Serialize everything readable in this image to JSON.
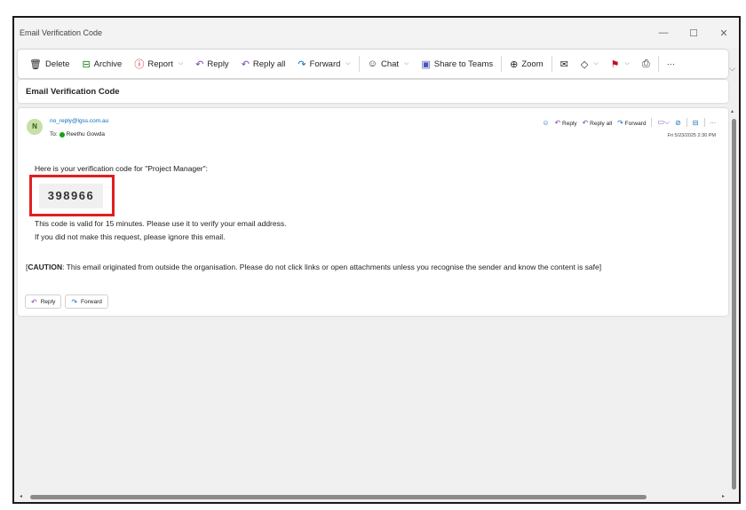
{
  "window": {
    "title": "Email Verification Code",
    "minimize": "—",
    "maximize": "☐",
    "close": "✕"
  },
  "toolbar": {
    "delete": "Delete",
    "archive": "Archive",
    "report": "Report",
    "reply": "Reply",
    "reply_all": "Reply all",
    "forward": "Forward",
    "chat": "Chat",
    "share_to_teams": "Share to Teams",
    "zoom": "Zoom",
    "more": "···"
  },
  "message": {
    "subject": "Email Verification Code",
    "avatar_initial": "N",
    "from": "no_reply@lgss.com.au",
    "to_label": "To:",
    "to_name": "Reethu Gowda",
    "date": "Fri 5/23/2025 2:30 PM",
    "actions": {
      "reply": "Reply",
      "reply_all": "Reply all",
      "forward": "Forward",
      "more": "···"
    },
    "intro": "Here is your verification code for \"Project Manager\":",
    "code": "398966",
    "line1": "This code is valid for 15 minutes. Please use it to verify your email address.",
    "line2": "If you did not make this request, please ignore this email.",
    "caution_label": "CAUTION",
    "caution_text": ": This email originated from outside the organisation. Please do not click links or open attachments unless you recognise the sender and know the content is safe",
    "bottom_reply": "Reply",
    "bottom_forward": "Forward"
  },
  "accent_color": "#0f6cbd",
  "highlight_color": "#e02020"
}
